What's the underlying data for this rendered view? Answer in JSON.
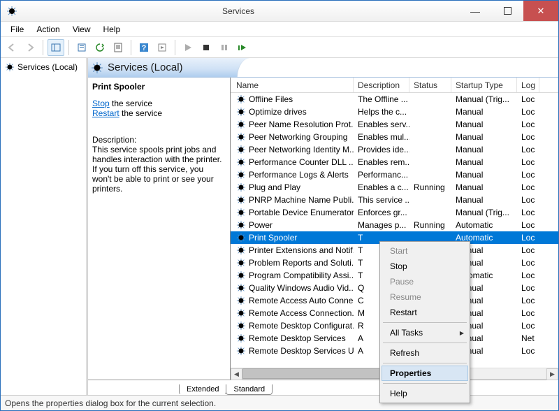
{
  "window": {
    "title": "Services"
  },
  "menu": {
    "file": "File",
    "action": "Action",
    "view": "View",
    "help": "Help"
  },
  "tree": {
    "root": "Services (Local)"
  },
  "header": {
    "title": "Services (Local)"
  },
  "actions": {
    "service_name": "Print Spooler",
    "stop_link": "Stop",
    "stop_suffix": " the service",
    "restart_link": "Restart",
    "restart_suffix": " the service",
    "desc_label": "Description:",
    "desc_text": "This service spools print jobs and handles interaction with the printer. If you turn off this service, you won't be able to print or see your printers."
  },
  "columns": {
    "name": "Name",
    "desc": "Description",
    "status": "Status",
    "startup": "Startup Type",
    "log": "Log"
  },
  "services": [
    {
      "name": "Offline Files",
      "desc": "The Offline ...",
      "status": "",
      "startup": "Manual (Trig...",
      "log": "Loc"
    },
    {
      "name": "Optimize drives",
      "desc": "Helps the c...",
      "status": "",
      "startup": "Manual",
      "log": "Loc"
    },
    {
      "name": "Peer Name Resolution Prot...",
      "desc": "Enables serv...",
      "status": "",
      "startup": "Manual",
      "log": "Loc"
    },
    {
      "name": "Peer Networking Grouping",
      "desc": "Enables mul...",
      "status": "",
      "startup": "Manual",
      "log": "Loc"
    },
    {
      "name": "Peer Networking Identity M...",
      "desc": "Provides ide...",
      "status": "",
      "startup": "Manual",
      "log": "Loc"
    },
    {
      "name": "Performance Counter DLL ...",
      "desc": "Enables rem...",
      "status": "",
      "startup": "Manual",
      "log": "Loc"
    },
    {
      "name": "Performance Logs & Alerts",
      "desc": "Performanc...",
      "status": "",
      "startup": "Manual",
      "log": "Loc"
    },
    {
      "name": "Plug and Play",
      "desc": "Enables a c...",
      "status": "Running",
      "startup": "Manual",
      "log": "Loc"
    },
    {
      "name": "PNRP Machine Name Publi...",
      "desc": "This service ...",
      "status": "",
      "startup": "Manual",
      "log": "Loc"
    },
    {
      "name": "Portable Device Enumerator...",
      "desc": "Enforces gr...",
      "status": "",
      "startup": "Manual (Trig...",
      "log": "Loc"
    },
    {
      "name": "Power",
      "desc": "Manages p...",
      "status": "Running",
      "startup": "Automatic",
      "log": "Loc"
    },
    {
      "name": "Print Spooler",
      "desc": "T",
      "status": "",
      "startup": "Automatic",
      "log": "Loc",
      "selected": true
    },
    {
      "name": "Printer Extensions and Notif...",
      "desc": "T",
      "status": "",
      "startup": "Manual",
      "log": "Loc"
    },
    {
      "name": "Problem Reports and Soluti...",
      "desc": "T",
      "status": "",
      "startup": "Manual",
      "log": "Loc"
    },
    {
      "name": "Program Compatibility Assi...",
      "desc": "T",
      "status": "",
      "startup": "Automatic",
      "log": "Loc"
    },
    {
      "name": "Quality Windows Audio Vid...",
      "desc": "Q",
      "status": "",
      "startup": "Manual",
      "log": "Loc"
    },
    {
      "name": "Remote Access Auto Conne...",
      "desc": "C",
      "status": "",
      "startup": "Manual",
      "log": "Loc"
    },
    {
      "name": "Remote Access Connection...",
      "desc": "M",
      "status": "",
      "startup": "Manual",
      "log": "Loc"
    },
    {
      "name": "Remote Desktop Configurat...",
      "desc": "R",
      "status": "",
      "startup": "Manual",
      "log": "Loc"
    },
    {
      "name": "Remote Desktop Services",
      "desc": "A",
      "status": "",
      "startup": "Manual",
      "log": "Net"
    },
    {
      "name": "Remote Desktop Services U...",
      "desc": "A",
      "status": "",
      "startup": "Manual",
      "log": "Loc"
    }
  ],
  "context_menu": {
    "start": "Start",
    "stop": "Stop",
    "pause": "Pause",
    "resume": "Resume",
    "restart": "Restart",
    "all_tasks": "All Tasks",
    "refresh": "Refresh",
    "properties": "Properties",
    "help": "Help"
  },
  "tabs": {
    "extended": "Extended",
    "standard": "Standard"
  },
  "statusbar": {
    "text": "Opens the properties dialog box for the current selection."
  }
}
